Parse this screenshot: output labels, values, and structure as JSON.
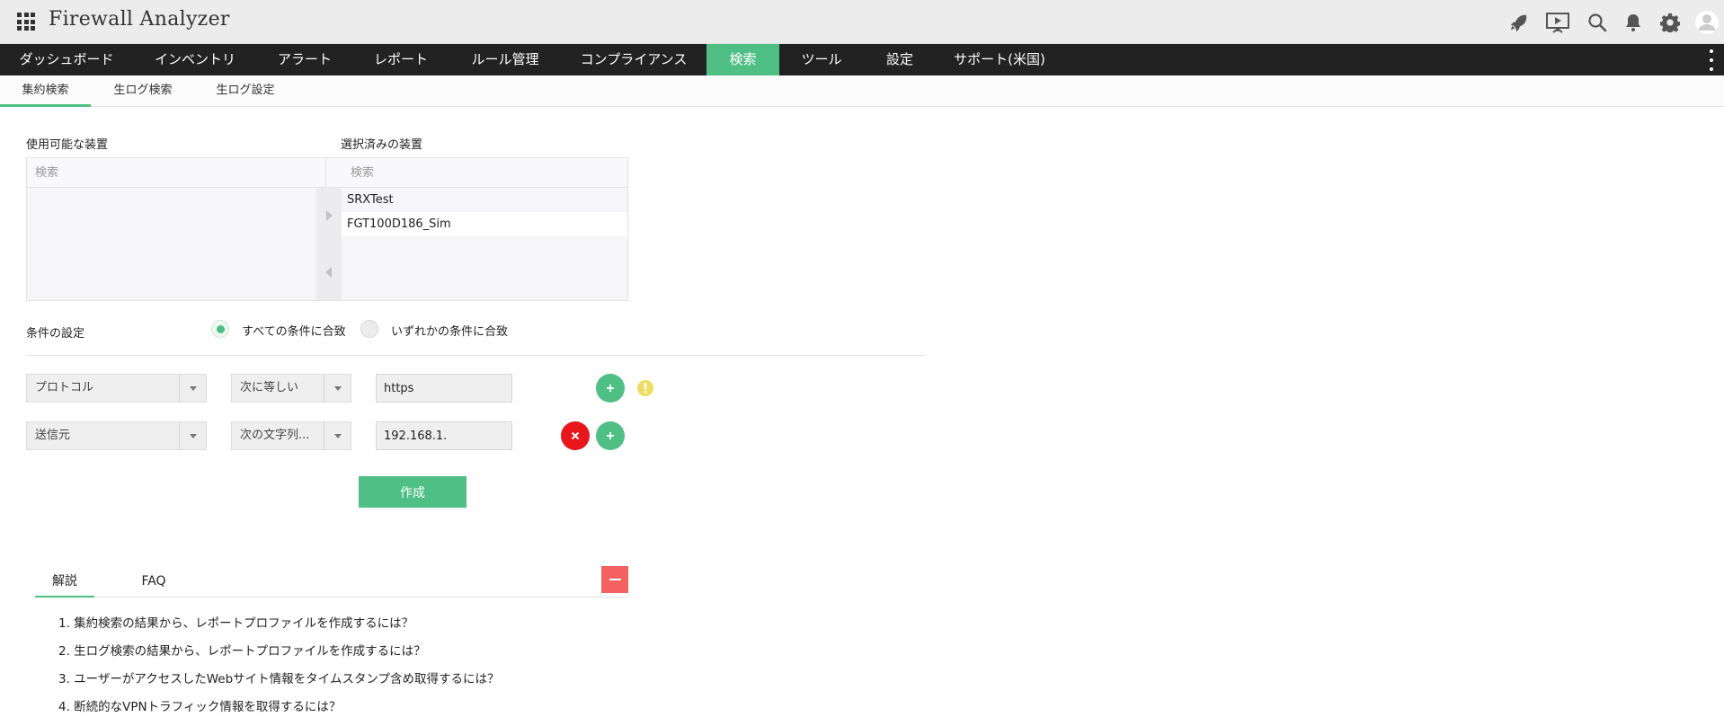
{
  "app": {
    "title": "Firewall Analyzer"
  },
  "header_icons": [
    "rocket-icon",
    "presentation-icon",
    "search-icon",
    "bell-icon",
    "gear-icon",
    "user-avatar-icon"
  ],
  "main_nav": {
    "items": [
      {
        "label": "ダッシュボード"
      },
      {
        "label": "インベントリ"
      },
      {
        "label": "アラート"
      },
      {
        "label": "レポート"
      },
      {
        "label": "ルール管理"
      },
      {
        "label": "コンプライアンス"
      },
      {
        "label": "検索",
        "active": true
      },
      {
        "label": "ツール"
      },
      {
        "label": "設定"
      },
      {
        "label": "サポート(米国)"
      }
    ]
  },
  "sub_nav": {
    "tabs": [
      {
        "label": "集約検索",
        "active": true
      },
      {
        "label": "生ログ検索"
      },
      {
        "label": "生ログ設定"
      }
    ]
  },
  "devices": {
    "available_label": "使用可能な装置",
    "selected_label": "選択済みの装置",
    "available_search_placeholder": "検索",
    "selected_search_placeholder": "検索",
    "selected_items": [
      "SRXTest",
      "FGT100D186_Sim"
    ]
  },
  "conditions": {
    "label": "条件の設定",
    "match_all": "すべての条件に合致",
    "match_any": "いずれかの条件に合致",
    "selected": "match_all"
  },
  "filters": [
    {
      "field": "プロトコル",
      "operator": "次に等しい",
      "value": "https"
    },
    {
      "field": "送信元",
      "operator": "次の文字列...",
      "value": "192.168.1."
    }
  ],
  "actions": {
    "create_label": "作成"
  },
  "help": {
    "tabs": [
      {
        "label": "解説",
        "active": true
      },
      {
        "label": "FAQ"
      }
    ],
    "items": [
      "1. 集約検索の結果から、レポートプロファイルを作成するには？",
      "2. 生ログ検索の結果から、レポートプロファイルを作成するには？",
      "3. ユーザーがアクセスしたWebサイト情報をタイムスタンプ含め取得するには？",
      "4. 断続的なVPNトラフィック情報を取得するには？"
    ]
  },
  "colors": {
    "accent": "#4fbf86",
    "nav_background": "#222222",
    "danger": "#e8161b",
    "warning": "#efdd63",
    "collapse": "#f36161"
  }
}
